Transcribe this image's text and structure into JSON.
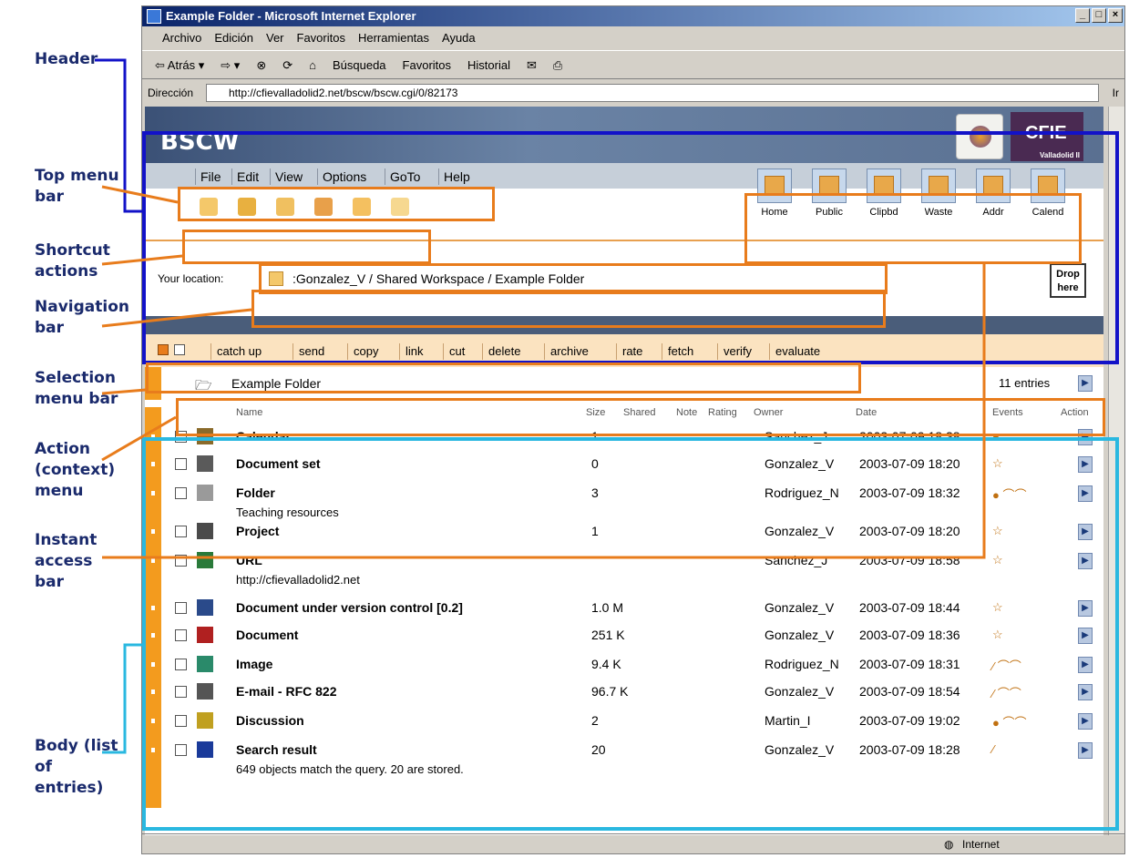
{
  "window": {
    "title": "Example Folder - Microsoft Internet Explorer",
    "buttons": [
      "_",
      "□",
      "×"
    ]
  },
  "ie_menu": [
    "Archivo",
    "Edición",
    "Ver",
    "Favoritos",
    "Herramientas",
    "Ayuda"
  ],
  "ie_toolbar": [
    "⇦ Atrás ▾",
    "⇨ ▾",
    "Búsqueda",
    "Favoritos",
    "Historial"
  ],
  "address": {
    "label": "Dirección",
    "url": "http://cfievalladolid2.net/bscw/bscw.cgi/0/82173",
    "go": "Ir"
  },
  "status": {
    "zone": "Internet"
  },
  "annotations": {
    "header": "Header",
    "top_menu": "Top menu bar",
    "shortcut": "Shortcut actions",
    "nav": "Navigation bar",
    "selection": "Selection menu bar",
    "action": "Action (context) menu",
    "instant": "Instant access bar",
    "body": "Body (list of entries)"
  },
  "bscw": {
    "logo": "BSCW",
    "logo2": "CFIE",
    "logo2_sub": "Valladolid II",
    "top_menu": [
      "File",
      "Edit",
      "View",
      "Options",
      "GoTo",
      "Help"
    ],
    "quick_access": [
      "Home",
      "Public",
      "Clipbd",
      "Waste",
      "Addr",
      "Calend"
    ],
    "location_label": "Your location:",
    "location_path": ":Gonzalez_V / Shared Workspace  / Example Folder",
    "drop": "Drop here",
    "selection_menu": [
      "catch up",
      "send",
      "copy",
      "link",
      "cut",
      "delete",
      "archive",
      "rate",
      "fetch",
      "verify",
      "evaluate"
    ],
    "folder": {
      "name": "Example Folder",
      "count": "11 entries"
    },
    "columns": {
      "name": "Name",
      "size": "Size",
      "shared": "Shared",
      "note": "Note",
      "rating": "Rating",
      "owner": "Owner",
      "date": "Date",
      "events": "Events",
      "action": "Action"
    },
    "entries": [
      {
        "name": "Calendar",
        "sub": "",
        "size": "1",
        "owner": "Sanchez_J",
        "date": "2003-07-09 18:38",
        "events": "●"
      },
      {
        "name": "Document set",
        "sub": "",
        "size": "0",
        "owner": "Gonzalez_V",
        "date": "2003-07-09 18:20",
        "events": "☆"
      },
      {
        "name": "Folder",
        "sub": "Teaching resources",
        "size": "3",
        "owner": "Rodriguez_N",
        "date": "2003-07-09 18:32",
        "events": "● ⌒⌒"
      },
      {
        "name": "Project",
        "sub": "",
        "size": "1",
        "owner": "Gonzalez_V",
        "date": "2003-07-09 18:20",
        "events": "☆"
      },
      {
        "name": "URL",
        "sub": "http://cfievalladolid2.net",
        "size": "",
        "owner": "Sanchez_J",
        "date": "2003-07-09 18:58",
        "events": "☆"
      },
      {
        "name": "Document under version control [0.2]",
        "sub": "",
        "size": "1.0 M",
        "owner": "Gonzalez_V",
        "date": "2003-07-09 18:44",
        "events": "☆"
      },
      {
        "name": "Document",
        "sub": "",
        "size": "251 K",
        "owner": "Gonzalez_V",
        "date": "2003-07-09 18:36",
        "events": "☆"
      },
      {
        "name": "Image",
        "sub": "",
        "size": "9.4 K",
        "owner": "Rodriguez_N",
        "date": "2003-07-09 18:31",
        "events": "⁄ ⌒⌒"
      },
      {
        "name": "E-mail - RFC 822",
        "sub": "",
        "size": "96.7 K",
        "owner": "Gonzalez_V",
        "date": "2003-07-09 18:54",
        "events": "⁄ ⌒⌒"
      },
      {
        "name": "Discussion",
        "sub": "",
        "size": "2",
        "owner": "Martin_I",
        "date": "2003-07-09 19:02",
        "events": "● ⌒⌒"
      },
      {
        "name": "Search result",
        "sub": "649 objects match the query. 20 are stored.",
        "size": "20",
        "owner": "Gonzalez_V",
        "date": "2003-07-09 18:28",
        "events": "⁄"
      }
    ]
  }
}
